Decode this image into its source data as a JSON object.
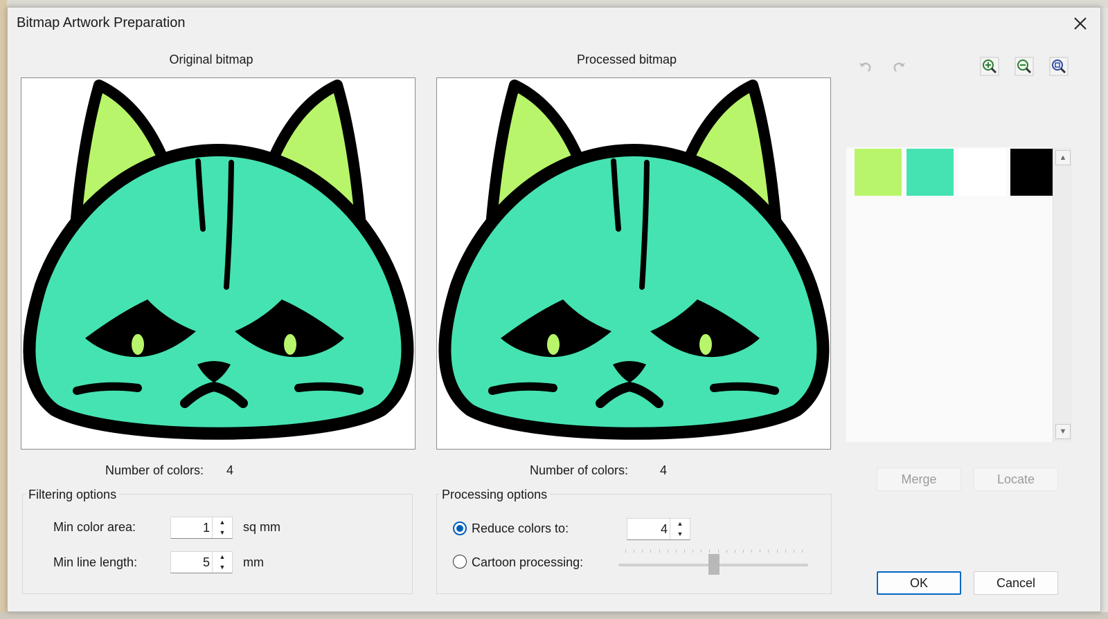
{
  "dialog": {
    "title": "Bitmap Artwork Preparation"
  },
  "original": {
    "caption": "Original bitmap",
    "colors_label": "Number of colors:",
    "colors_value": "4"
  },
  "processed": {
    "caption": "Processed bitmap",
    "colors_label": "Number of colors:",
    "colors_value": "4"
  },
  "filtering": {
    "title": "Filtering options",
    "min_color_area_label": "Min color area:",
    "min_color_area_value": "1",
    "min_color_area_unit": "sq mm",
    "min_line_length_label": "Min line length:",
    "min_line_length_value": "5",
    "min_line_length_unit": "mm"
  },
  "processing": {
    "title": "Processing options",
    "reduce_label": "Reduce colors to:",
    "reduce_value": "4",
    "reduce_selected": true,
    "cartoon_label": "Cartoon processing:",
    "cartoon_selected": false,
    "cartoon_level": 0.5
  },
  "palette": {
    "colors": [
      "#b8f56a",
      "#45e3b1",
      "#ffffff",
      "#000000"
    ]
  },
  "toolbar": {
    "icons": [
      "undo-icon",
      "redo-icon",
      "zoom-in-icon",
      "zoom-out-icon",
      "zoom-fit-icon"
    ]
  },
  "buttons": {
    "merge": "Merge",
    "locate": "Locate",
    "ok": "OK",
    "cancel": "Cancel"
  },
  "theme": {
    "cat_fill": "#45e3b1",
    "ear_fill": "#b8f56a",
    "outline": "#000000",
    "accent": "#005fb8"
  }
}
